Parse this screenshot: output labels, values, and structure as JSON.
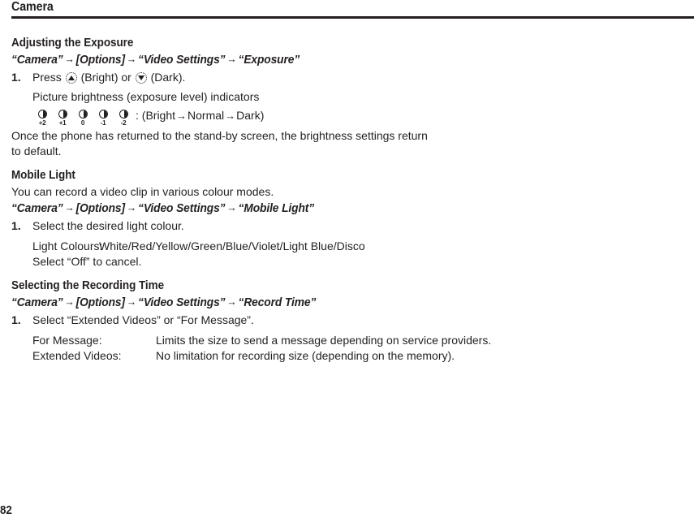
{
  "header": {
    "running_title": "Camera"
  },
  "folio": {
    "page_number": "82"
  },
  "sections": [
    {
      "heading": "Adjusting the Exposure",
      "path": {
        "parts": [
          "“Camera”",
          "[Options]",
          "“Video Settings”",
          "“Exposure”"
        ],
        "arrow": "→"
      },
      "step_number": "1.",
      "step_text_before": "Press",
      "step_text_mid": "(Bright) or",
      "step_text_after": "(Dark).",
      "sub_text": "Picture brightness (exposure level) indicators",
      "indicators": [
        {
          "level": "+2"
        },
        {
          "level": "+1"
        },
        {
          "level": "0"
        },
        {
          "level": "-1"
        },
        {
          "level": "-2"
        }
      ],
      "indicator_caption": ": (Bright",
      "indicator_caption_mid": "Normal",
      "indicator_caption_end": "Dark)",
      "note": "Once the phone has returned to the stand-by screen, the brightness settings return to default."
    },
    {
      "heading": "Mobile Light",
      "lead": "You can record a video clip in various colour modes.",
      "path": {
        "parts": [
          "“Camera”",
          "[Options]",
          "“Video Settings”",
          "“Mobile Light”"
        ],
        "arrow": "→"
      },
      "step_number": "1.",
      "step_text": "Select the desired light colour.",
      "definitions": [
        {
          "term": "Light Colours:",
          "desc": "White/Red/Yellow/Green/Blue/Violet/Light Blue/Disco"
        }
      ],
      "cancel_note": "Select “Off” to cancel."
    },
    {
      "heading": "Selecting the Recording Time",
      "path": {
        "parts": [
          "“Camera”",
          "[Options]",
          "“Video Settings”",
          "“Record Time”"
        ],
        "arrow": "→"
      },
      "step_number": "1.",
      "step_text": "Select “Extended Videos” or “For Message”.",
      "definitions": [
        {
          "term": "For Message:",
          "desc": "Limits the size to send a message depending on service providers."
        },
        {
          "term": "Extended Videos:",
          "desc": "No limitation for recording size (depending on the memory)."
        }
      ]
    }
  ]
}
